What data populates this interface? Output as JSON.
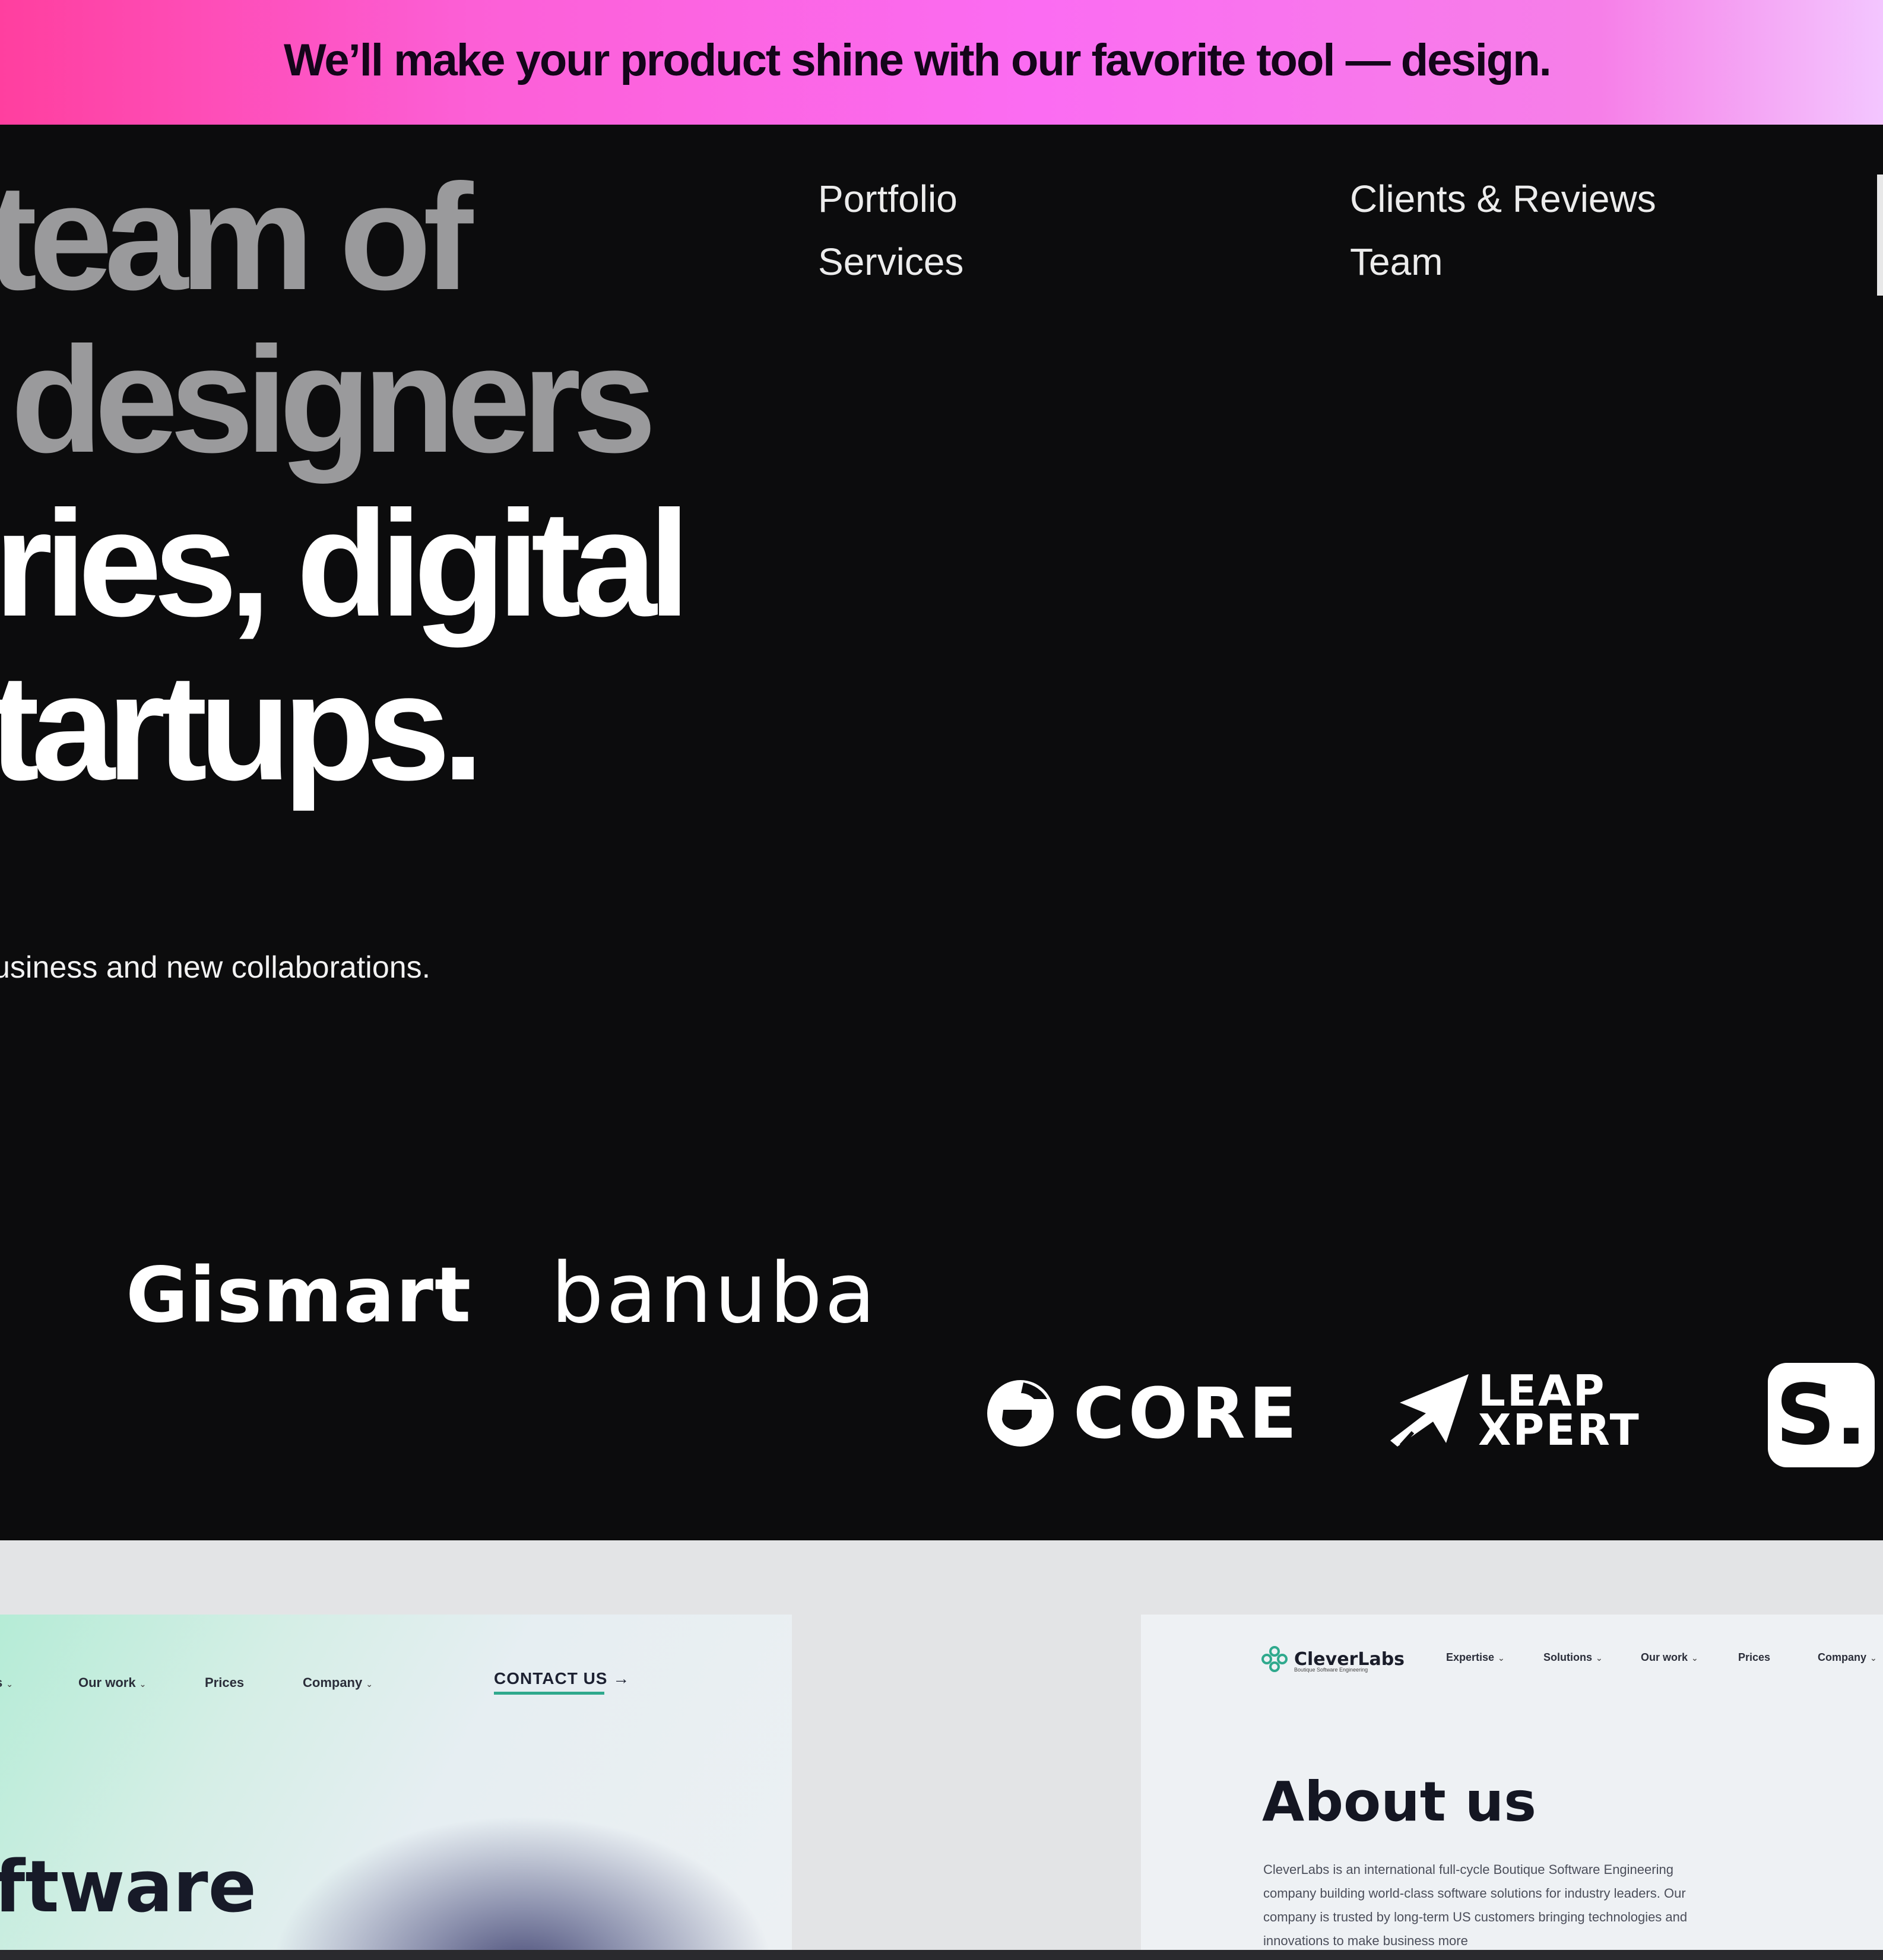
{
  "banner": {
    "text": "We’ll make your product shine with our favorite tool  —  design."
  },
  "hero": {
    "lines": [
      "team of",
      "designers",
      "ries, digital",
      "tartups."
    ],
    "tagline": "usiness and new collaborations."
  },
  "nav": {
    "portfolio": "Portfolio",
    "services": "Services",
    "clients": "Clients & Reviews",
    "team": "Team"
  },
  "logos": {
    "gismart": "Gismart",
    "banuba": "banuba",
    "core": "CORE",
    "leap_line1": "LEAP",
    "leap_line2": "XPERT",
    "s_badge": "S."
  },
  "gallery": {
    "left_card": {
      "nav": [
        "s",
        "Our work",
        "Prices",
        "Company"
      ],
      "contact": "CONTACT US →",
      "heading": "ftware"
    },
    "right_card": {
      "logo_name": "CleverLabs",
      "logo_sub": "Boutique Software Engineering",
      "nav": [
        "Expertise",
        "Solutions",
        "Our work",
        "Prices",
        "Company"
      ],
      "heading": "About us",
      "paragraph": "CleverLabs is an international full-cycle Boutique Software Engineering company building world-class software solutions for industry leaders. Our company is trusted by long-term US customers bringing technologies and innovations to make business more"
    }
  },
  "colors": {
    "background": "#0c0c0d",
    "heading_grey": "#9a9a9c",
    "accent_green": "#2fa98d",
    "banner_pink": "#fb6cf2"
  },
  "icons": {
    "arrow": "arrow-right-icon",
    "core_logo": "core-g-icon",
    "leap_logo": "leap-plane-icon",
    "cleverlabs_logo": "cleverlabs-flower-icon"
  }
}
